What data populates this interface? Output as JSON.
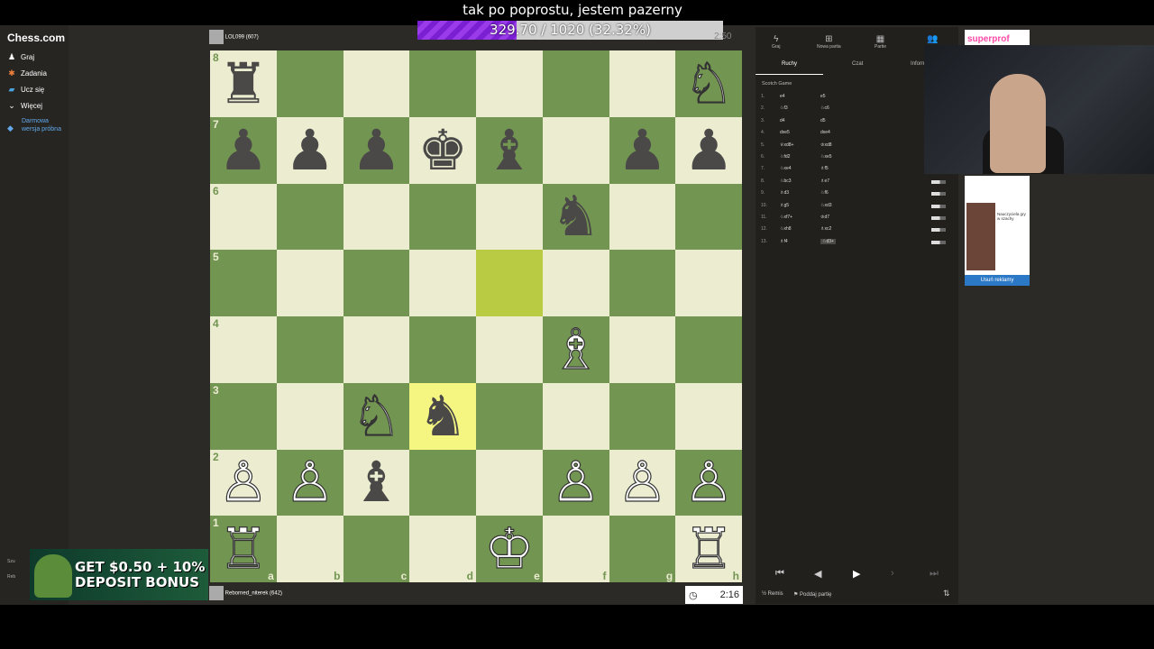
{
  "stream": {
    "title": "tak po poprostu, jestem pazerny",
    "goal": {
      "text": "329.70 / 1020 (32.32%)",
      "progress": 0.3232
    }
  },
  "sidebar": {
    "logo": "Chess.com",
    "items": [
      {
        "label": "Graj",
        "icon": "pawn-icon"
      },
      {
        "label": "Zadania",
        "icon": "puzzle-icon"
      },
      {
        "label": "Ucz się",
        "icon": "book-icon"
      },
      {
        "label": "Więcej",
        "icon": "chevron-down-icon"
      }
    ],
    "trial": "Darmowa wersja próbna",
    "bottom_items": [
      "Szu",
      "Reb"
    ]
  },
  "top_player": {
    "name": "LOL099 (607)",
    "clock": "2:50"
  },
  "bottom_player": {
    "name": "Reborned_niterek (642)",
    "clock": "2:16"
  },
  "board": {
    "ranks": [
      "8",
      "7",
      "6",
      "5",
      "4",
      "3",
      "2",
      "1"
    ],
    "files": [
      "a",
      "b",
      "c",
      "d",
      "e",
      "f",
      "g",
      "h"
    ],
    "pieces": {
      "a8": "♜",
      "h8": "♘",
      "a7": "♟",
      "b7": "♟",
      "c7": "♟",
      "d7": "♚",
      "e7": "♝",
      "g7": "♟",
      "h7": "♟",
      "f6": "♞",
      "f4": "♗",
      "c3": "♘",
      "d3": "♞",
      "a2": "♙",
      "b2": "♙",
      "c2": "♝",
      "f2": "♙",
      "g2": "♙",
      "h2": "♙",
      "a1": "♖",
      "e1": "♔",
      "h1": "♖"
    },
    "highlight": [
      "e5",
      "d3"
    ],
    "colors": {
      "light": "#ebecd0",
      "dark": "#739552",
      "hl_light": "#f5f682",
      "hl_dark": "#b9ca43"
    }
  },
  "panel": {
    "top_tabs": [
      {
        "label": "Graj",
        "icon": "bolt-icon"
      },
      {
        "label": "Nowa partia",
        "icon": "plus-icon"
      },
      {
        "label": "Partie",
        "icon": "grid-icon"
      },
      {
        "label": "",
        "icon": "friends-icon"
      }
    ],
    "sub_tabs": [
      "Ruchy",
      "Czat",
      "Inform"
    ],
    "opening": "Scotch Game",
    "moves": [
      {
        "n": "1.",
        "w": "e4",
        "b": "e5"
      },
      {
        "n": "2.",
        "w": "♘f3",
        "b": "♘c6"
      },
      {
        "n": "3.",
        "w": "d4",
        "b": "d5"
      },
      {
        "n": "4.",
        "w": "dxe5",
        "b": "dxe4"
      },
      {
        "n": "5.",
        "w": "♕xd8+",
        "b": "♔xd8"
      },
      {
        "n": "6.",
        "w": "♘fd2",
        "b": "♘xe5"
      },
      {
        "n": "7.",
        "w": "♘xe4",
        "b": "♗f5"
      },
      {
        "n": "8.",
        "w": "♘bc3",
        "b": "♗e7"
      },
      {
        "n": "9.",
        "w": "♗d3",
        "b": "♘f6"
      },
      {
        "n": "10.",
        "w": "♗g5",
        "b": "♘xd3"
      },
      {
        "n": "11.",
        "w": "♘xf7+",
        "b": "♔d7"
      },
      {
        "n": "12.",
        "w": "♘xh8",
        "b": "♗xc2"
      },
      {
        "n": "13.",
        "w": "♗f4",
        "b": "♘d3+"
      }
    ],
    "footer": {
      "draw": "Remis",
      "resign": "Poddaj partię"
    }
  },
  "ads": {
    "top_text": "superprof",
    "side_remove": "Usuń reklamy",
    "side_caption": "Nauczyciela gry w szachy",
    "bonus_text": "GET $0.50 + 10% DEPOSIT BONUS"
  }
}
